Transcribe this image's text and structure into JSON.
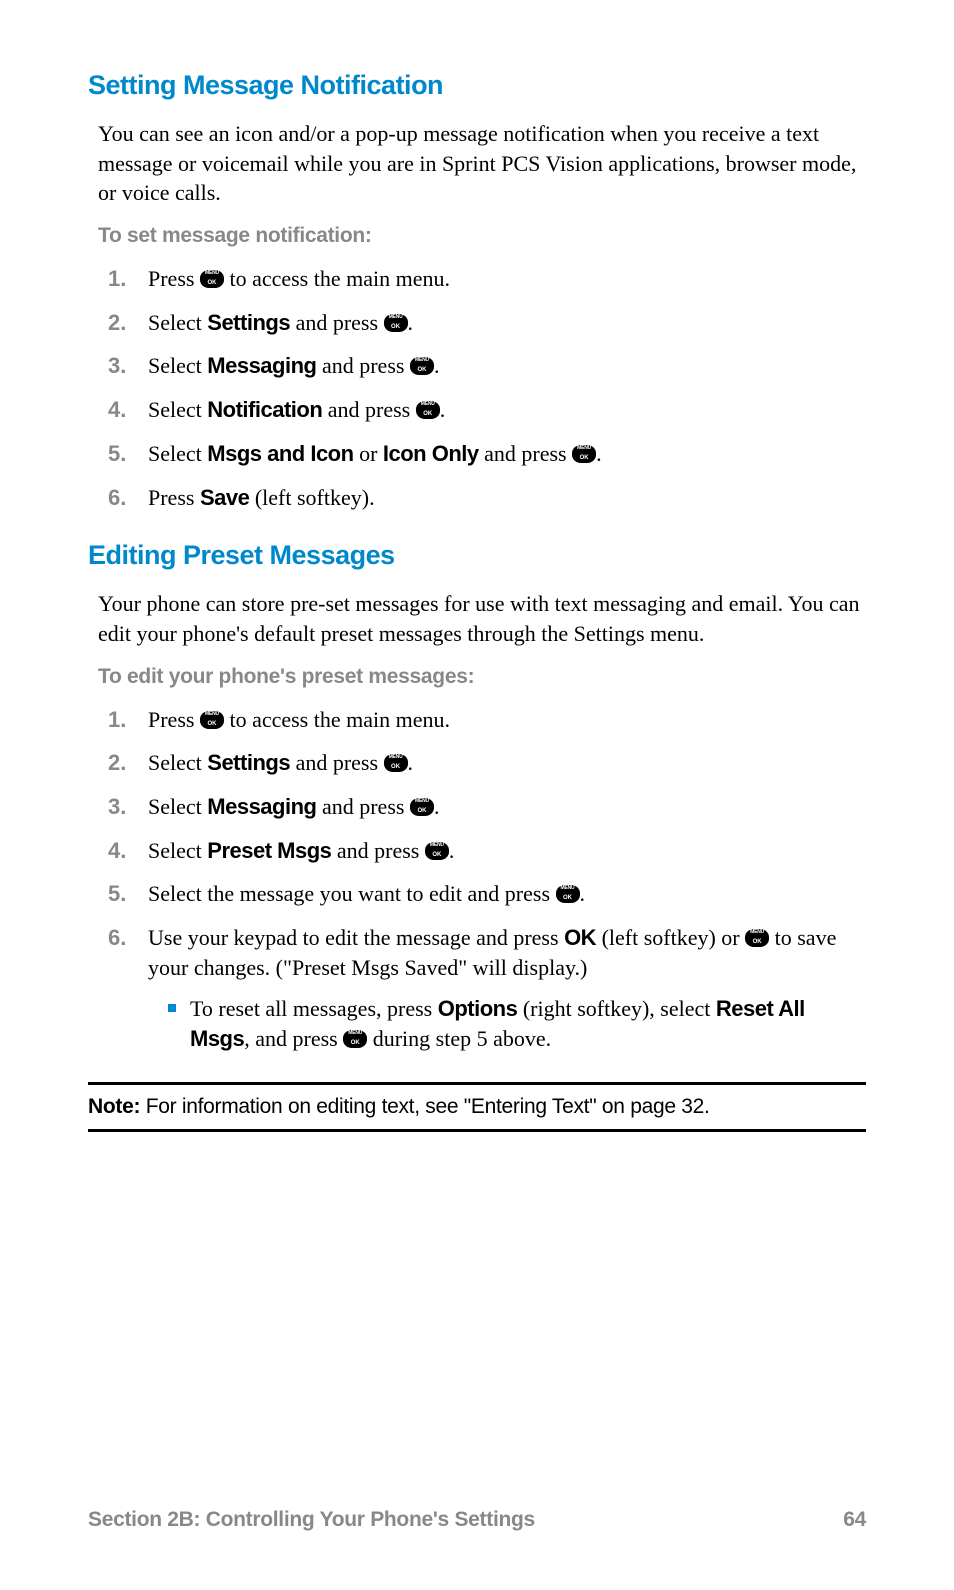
{
  "section1": {
    "heading": "Setting Message Notification",
    "intro": "You can see an icon and/or a pop-up message notification when you receive a text message or voicemail while you are in Sprint PCS Vision applications, browser mode, or voice calls.",
    "subhead": "To set message notification:",
    "steps": {
      "n1": "1.",
      "s1a": "Press ",
      "s1b": " to access the main menu.",
      "n2": "2.",
      "s2a": "Select ",
      "s2b": "Settings",
      "s2c": " and press ",
      "s2d": ".",
      "n3": "3.",
      "s3a": "Select ",
      "s3b": "Messaging",
      "s3c": " and press ",
      "s3d": ".",
      "n4": "4.",
      "s4a": "Select ",
      "s4b": "Notification",
      "s4c": " and press ",
      "s4d": ".",
      "n5": "5.",
      "s5a": "Select ",
      "s5b": "Msgs and Icon",
      "s5c": " or ",
      "s5d": "Icon Only",
      "s5e": " and press ",
      "s5f": ".",
      "n6": "6.",
      "s6a": "Press ",
      "s6b": "Save",
      "s6c": " (left softkey)."
    }
  },
  "section2": {
    "heading": "Editing Preset Messages",
    "intro": "Your phone can store pre-set messages for use with text messaging and email. You can edit your phone's default preset messages through the Settings menu.",
    "subhead": "To edit your phone's preset messages:",
    "steps": {
      "n1": "1.",
      "s1a": "Press ",
      "s1b": " to access the main menu.",
      "n2": "2.",
      "s2a": "Select ",
      "s2b": "Settings",
      "s2c": " and press ",
      "s2d": ".",
      "n3": "3.",
      "s3a": "Select ",
      "s3b": "Messaging",
      "s3c": " and press ",
      "s3d": ".",
      "n4": "4.",
      "s4a": "Select ",
      "s4b": "Preset Msgs",
      "s4c": " and press ",
      "s4d": ".",
      "n5": "5.",
      "s5a": "Select the message you want to edit and press ",
      "s5b": ".",
      "n6": "6.",
      "s6a": "Use your keypad to edit the message and press ",
      "s6b": "OK",
      "s6c": " (left softkey) or ",
      "s6d": " to save your changes. (\"Preset Msgs Saved\" will display.)",
      "bullet_a": "To reset all messages, press ",
      "bullet_b": "Options",
      "bullet_c": " (right softkey), select ",
      "bullet_d": "Reset All Msgs",
      "bullet_e": ", and press ",
      "bullet_f": " during step 5 above."
    }
  },
  "note": {
    "label": "Note:",
    "text": " For information on editing text, see \"Entering Text\" on page 32."
  },
  "footer": {
    "section": "Section 2B: Controlling Your Phone's Settings",
    "page": "64"
  }
}
